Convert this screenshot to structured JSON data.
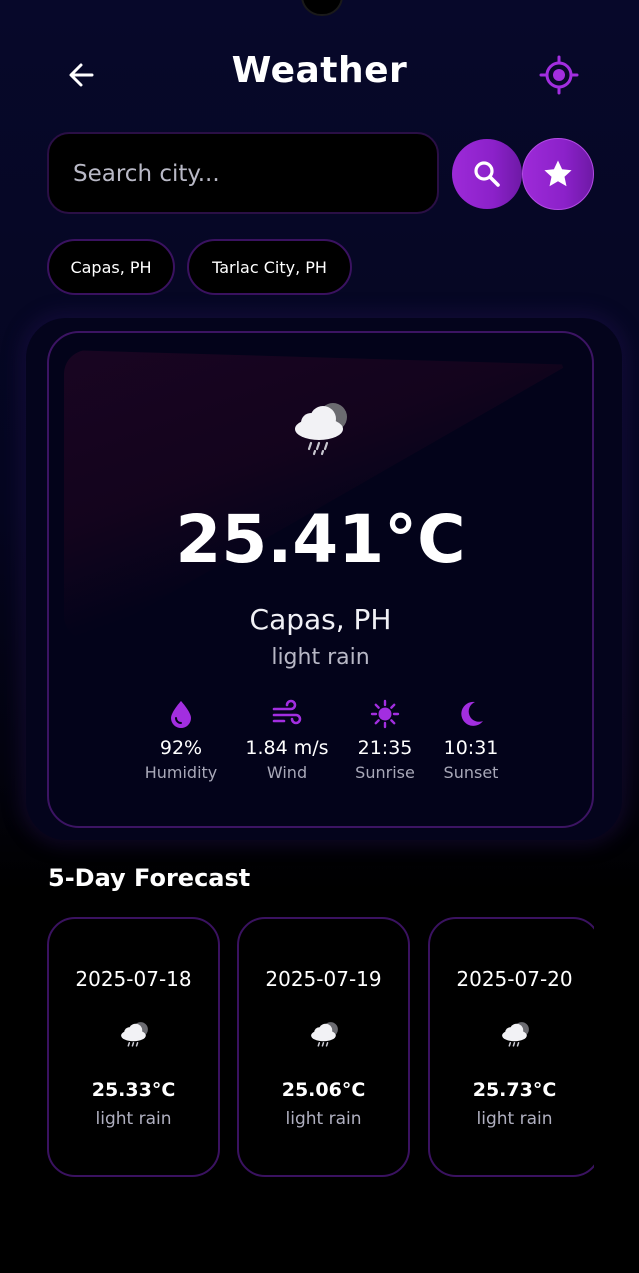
{
  "header": {
    "title": "Weather",
    "back_icon": "arrow-left-icon",
    "locate_icon": "crosshair-location-icon"
  },
  "search": {
    "placeholder": "Search city...",
    "value": "",
    "search_icon": "search-icon",
    "favorite_icon": "star-icon"
  },
  "recent_cities": [
    {
      "label": "Capas, PH"
    },
    {
      "label": "Tarlac City, PH"
    }
  ],
  "current": {
    "icon": "cloud-rain-moon-icon",
    "temperature": "25.41°C",
    "city": "Capas, PH",
    "description": "light rain",
    "stats": [
      {
        "icon": "droplet-icon",
        "value": "92%",
        "label": "Humidity"
      },
      {
        "icon": "wind-icon",
        "value": "1.84 m/s",
        "label": "Wind"
      },
      {
        "icon": "sun-icon",
        "value": "21:35",
        "label": "Sunrise"
      },
      {
        "icon": "moon-icon",
        "value": "10:31",
        "label": "Sunset"
      }
    ]
  },
  "forecast": {
    "title": "5-Day Forecast",
    "days": [
      {
        "date": "2025-07-18",
        "temp": "25.33°C",
        "description": "light rain",
        "icon": "cloud-rain-moon-icon"
      },
      {
        "date": "2025-07-19",
        "temp": "25.06°C",
        "description": "light rain",
        "icon": "cloud-rain-moon-icon"
      },
      {
        "date": "2025-07-20",
        "temp": "25.73°C",
        "description": "light rain",
        "icon": "cloud-rain-moon-icon"
      }
    ]
  },
  "colors": {
    "accent": "#9b2bd6",
    "background": "#000000",
    "card": "#03031a",
    "border": "#3c1463",
    "muted_text": "#b8b8c6"
  }
}
